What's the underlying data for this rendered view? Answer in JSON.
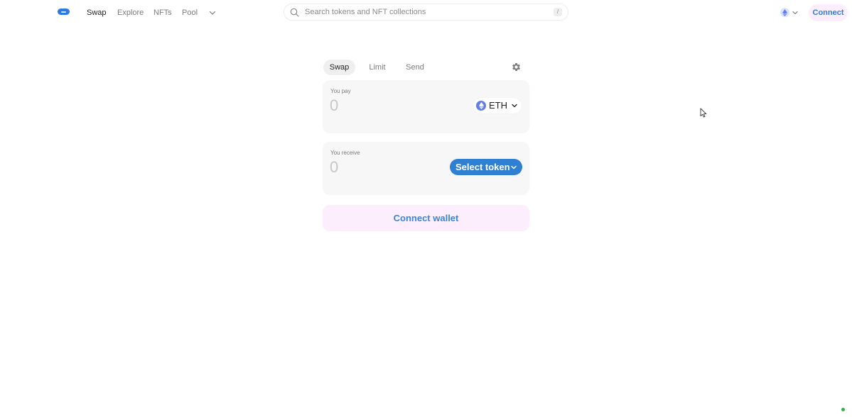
{
  "nav": {
    "links": [
      {
        "label": "Swap",
        "active": true
      },
      {
        "label": "Explore",
        "active": false
      },
      {
        "label": "NFTs",
        "active": false
      },
      {
        "label": "Pool",
        "active": false
      }
    ],
    "more_icon": "chevron-down-icon"
  },
  "search": {
    "placeholder": "Search tokens and NFT collections",
    "shortcut": "/",
    "icon": "search-icon"
  },
  "header": {
    "chain_icon": "ethereum-icon",
    "connect_label": "Connect"
  },
  "swap": {
    "tabs": [
      {
        "label": "Swap",
        "active": true
      },
      {
        "label": "Limit",
        "active": false
      },
      {
        "label": "Send",
        "active": false
      }
    ],
    "settings_icon": "gear-icon",
    "pay": {
      "label": "You pay",
      "amount_placeholder": "0",
      "token": "ETH"
    },
    "receive": {
      "label": "You receive",
      "amount_placeholder": "0",
      "select_label": "Select token"
    },
    "connect_wallet_label": "Connect wallet"
  },
  "colors": {
    "accent": "#2f7fd2",
    "accent_soft_bg": "#fdeefd",
    "panel_bg": "#f7f7f7",
    "eth": "#627eea",
    "status": "#2eb24b"
  }
}
